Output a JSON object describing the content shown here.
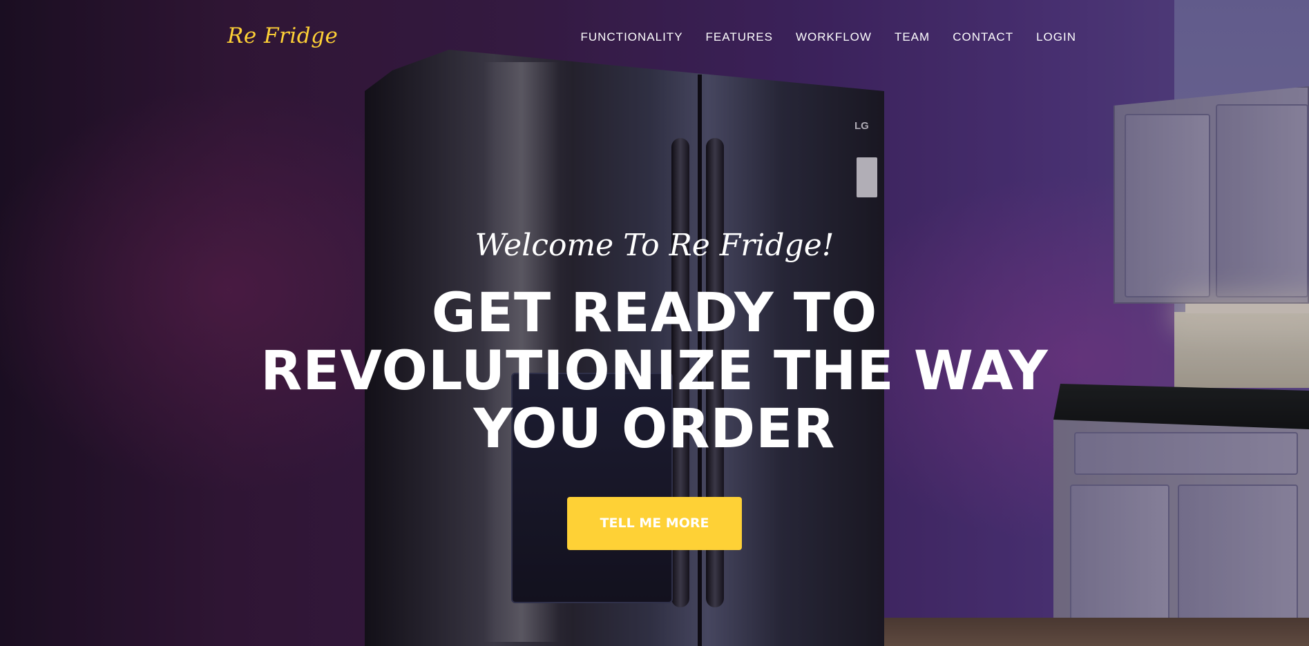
{
  "brand": {
    "name": "Re Fridge"
  },
  "nav": {
    "items": [
      {
        "label": "FUNCTIONALITY"
      },
      {
        "label": "FEATURES"
      },
      {
        "label": "WORKFLOW"
      },
      {
        "label": "TEAM"
      },
      {
        "label": "CONTACT"
      },
      {
        "label": "LOGIN"
      }
    ]
  },
  "hero": {
    "subheading": "Welcome To Re Fridge!",
    "heading": "GET READY TO REVOLUTIONIZE THE WAY YOU ORDER",
    "cta_label": "TELL ME MORE",
    "fridge_logo": "LG"
  },
  "colors": {
    "accent": "#fed136",
    "text": "#ffffff"
  }
}
